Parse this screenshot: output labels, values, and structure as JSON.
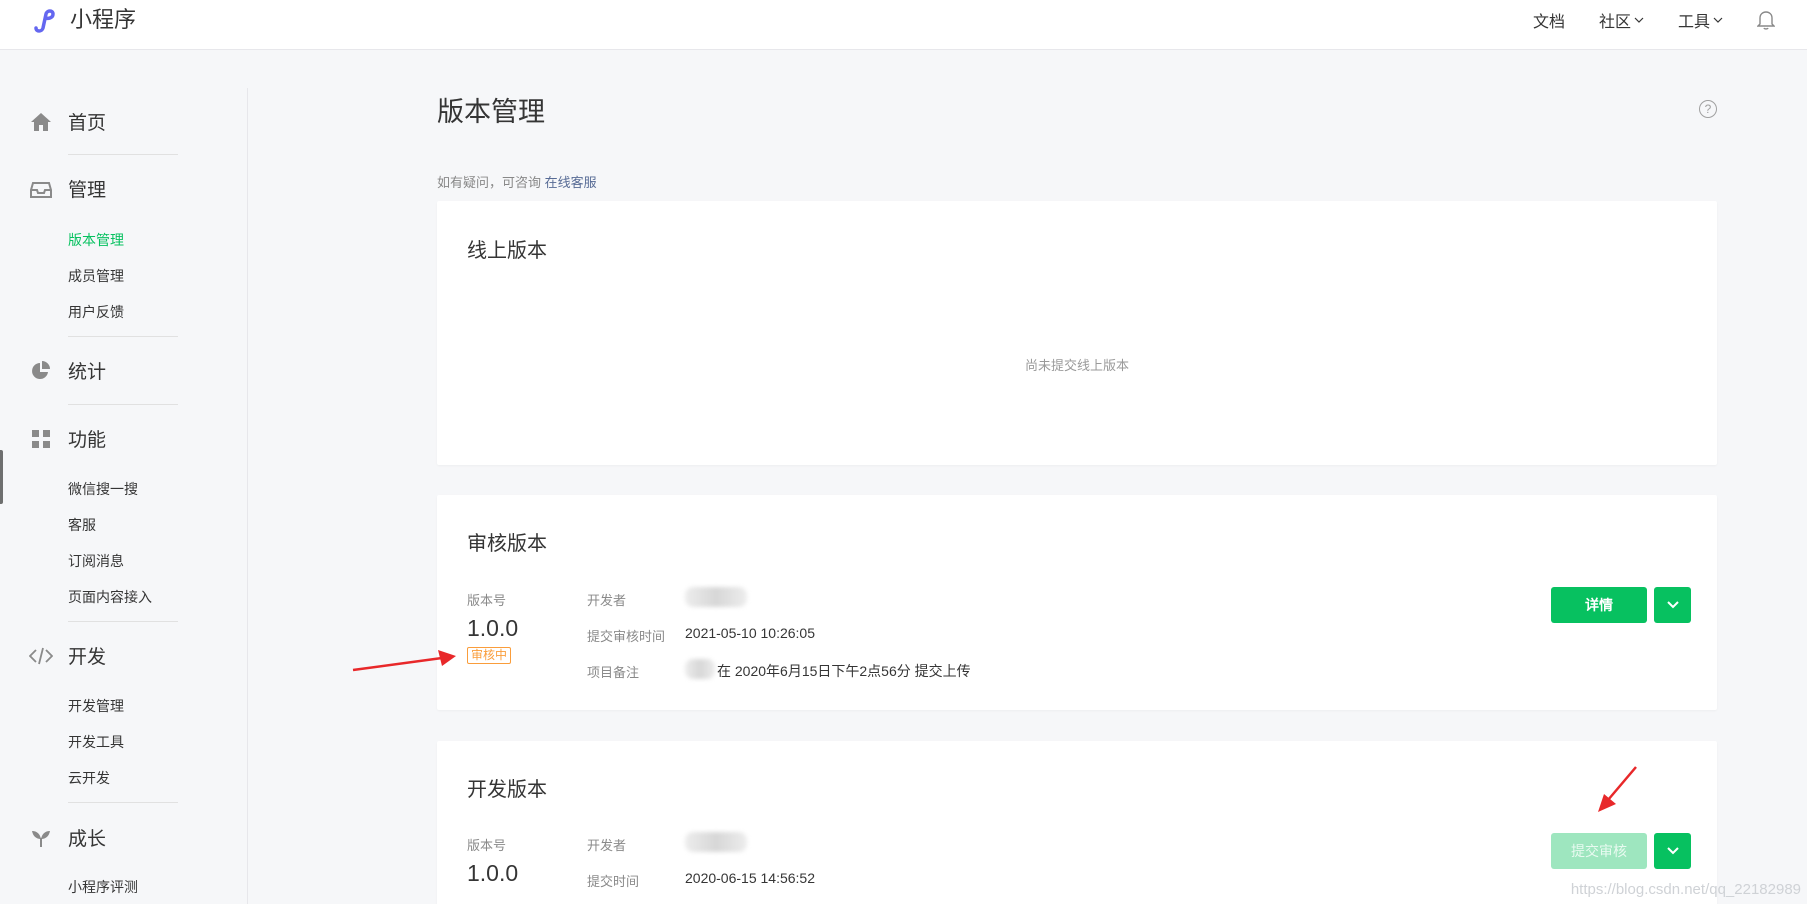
{
  "app": {
    "logo_text": "小程序"
  },
  "topnav": {
    "docs": "文档",
    "community": "社区",
    "tools": "工具"
  },
  "sidebar": {
    "home": "首页",
    "manage": {
      "label": "管理",
      "items": [
        "版本管理",
        "成员管理",
        "用户反馈"
      ]
    },
    "stats": "统计",
    "features": {
      "label": "功能",
      "items": [
        "微信搜一搜",
        "客服",
        "订阅消息",
        "页面内容接入"
      ]
    },
    "develop": {
      "label": "开发",
      "items": [
        "开发管理",
        "开发工具",
        "云开发"
      ]
    },
    "growth": {
      "label": "成长",
      "items": [
        "小程序评测"
      ]
    }
  },
  "main": {
    "title": "版本管理",
    "consult_text": "如有疑问，可咨询",
    "consult_link": "在线客服",
    "online": {
      "title": "线上版本",
      "empty": "尚未提交线上版本"
    },
    "review": {
      "title": "审核版本",
      "version_label": "版本号",
      "version": "1.0.0",
      "status": "审核中",
      "developer_label": "开发者",
      "submit_time_label": "提交审核时间",
      "submit_time": "2021-05-10 10:26:05",
      "note_label": "项目备注",
      "note": "在 2020年6月15日下午2点56分 提交上传",
      "detail_button": "详情"
    },
    "dev": {
      "title": "开发版本",
      "version_label": "版本号",
      "version": "1.0.0",
      "developer_label": "开发者",
      "submit_time_label": "提交时间",
      "submit_time": "2020-06-15 14:56:52",
      "submit_button": "提交审核"
    }
  },
  "watermark": "https://blog.csdn.net/qq_22182989",
  "colors": {
    "accent": "#07c160",
    "link": "#576b95",
    "warning": "#fa9d3b",
    "annotation": "#e8282a"
  }
}
